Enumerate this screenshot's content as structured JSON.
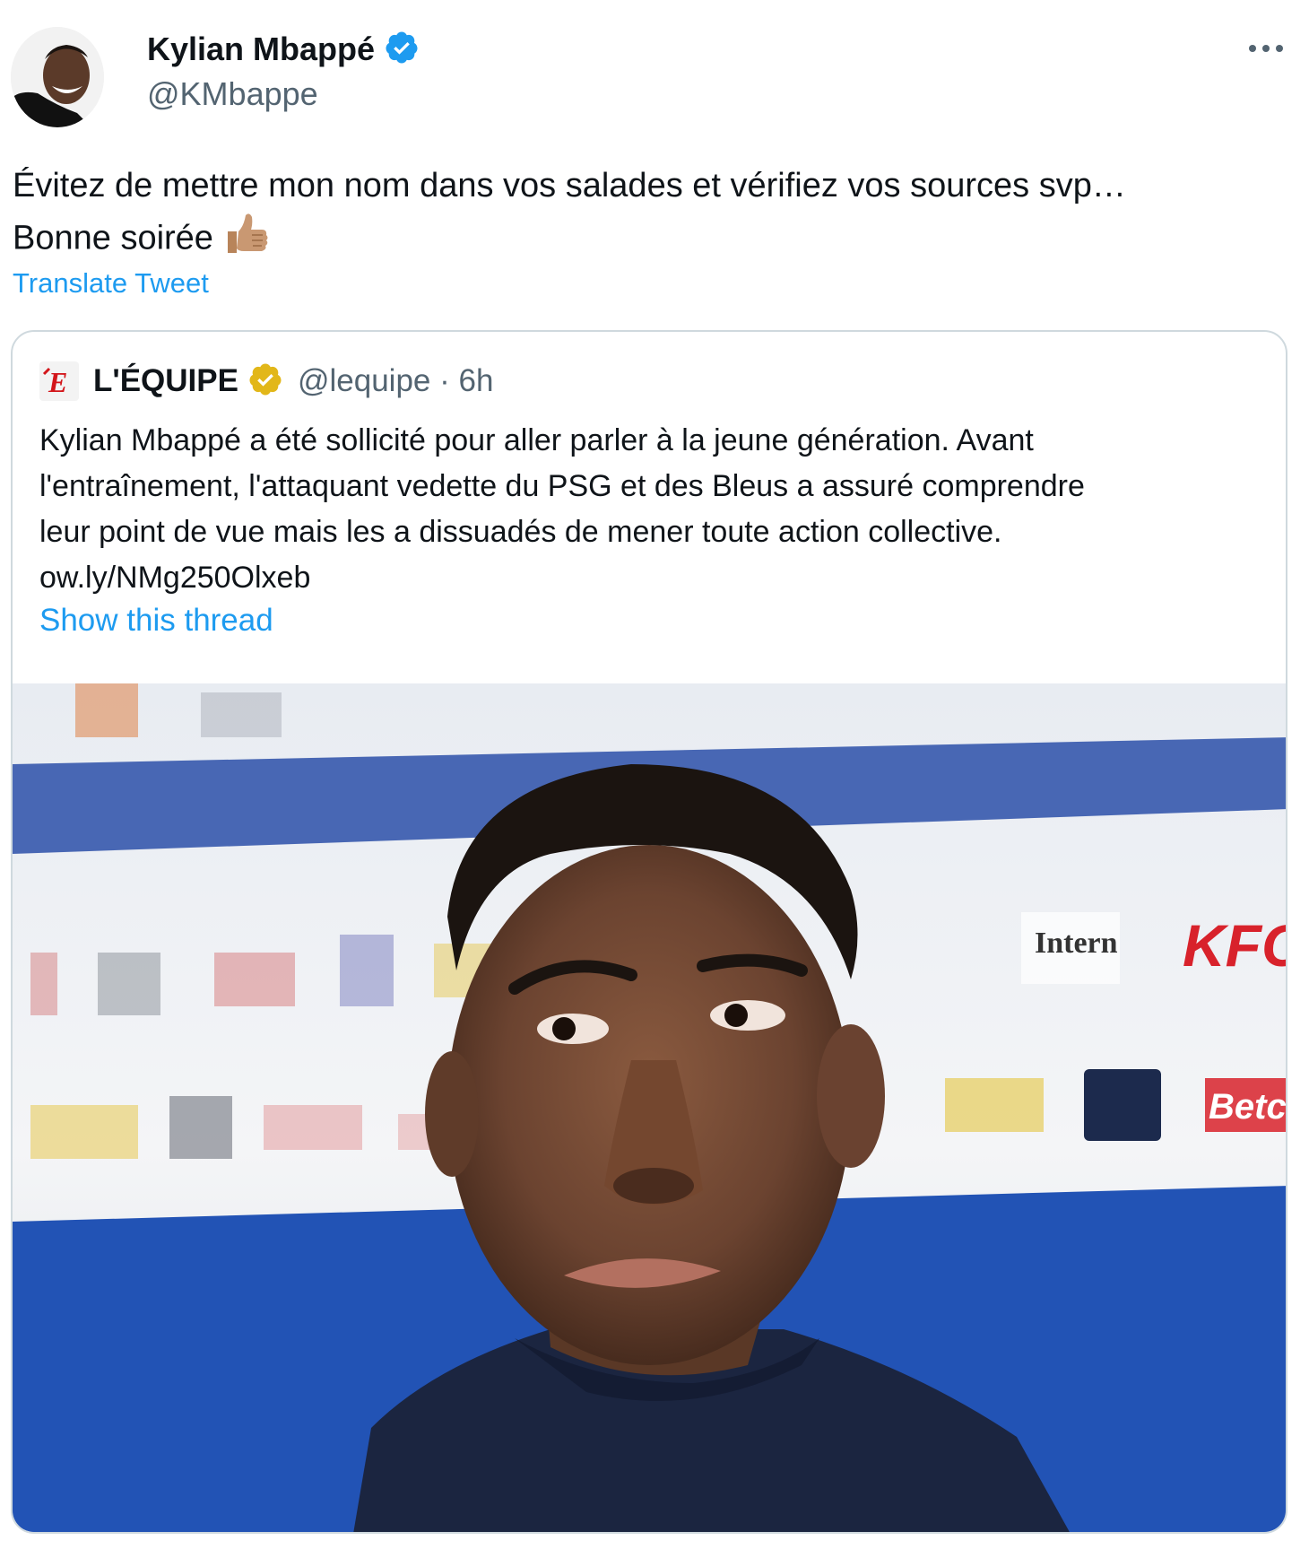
{
  "tweet": {
    "author_name": "Kylian Mbappé",
    "author_handle": "@KMbappe",
    "verified_color": "#1d9bf0",
    "text_lines": [
      "Évitez de mettre mon nom dans vos salades et vérifiez vos sources svp…",
      "Bonne soirée"
    ],
    "emoji": "thumbs-up-icon",
    "translate_label": "Translate Tweet",
    "more_icon": "more-icon"
  },
  "quote": {
    "author_name": "L'ÉQUIPE",
    "verified_color": "#e2b719",
    "handle_time": "@lequipe · 6h",
    "logo_letter": "E",
    "text_lines": [
      "Kylian Mbappé a été sollicité pour aller parler à la jeune génération. Avant",
      "l'entraînement, l'attaquant vedette du PSG et des Bleus a assuré comprendre",
      "leur point de vue mais les a dissuadés de mener toute action collective.",
      "ow.ly/NMg250Olxeb"
    ],
    "show_thread": "Show this thread",
    "media_sponsor_labels": [
      "KFC",
      "Betcl"
    ]
  },
  "colors": {
    "link": "#1d9bf0",
    "secondary": "#536471",
    "border": "#cfd9de"
  }
}
